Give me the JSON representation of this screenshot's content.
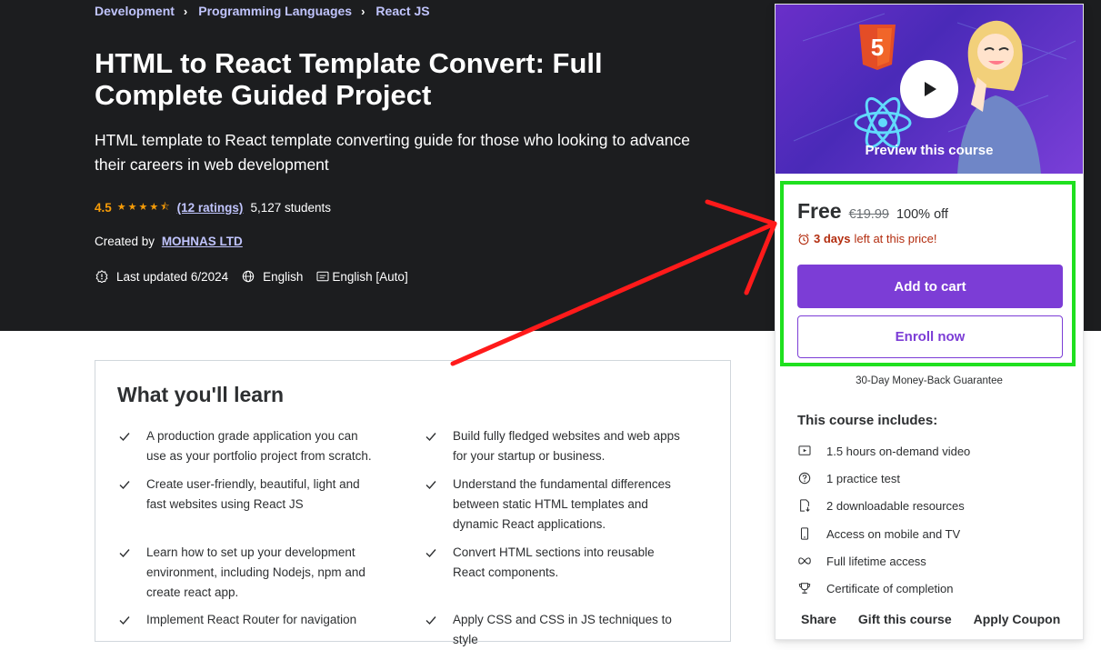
{
  "breadcrumbs": [
    "Development",
    "Programming Languages",
    "React JS"
  ],
  "course": {
    "title": "HTML to React Template Convert: Full Complete Guided Project",
    "subtitle": "HTML template to React template converting guide for those who looking to advance their careers in web development",
    "rating": "4.5",
    "stars": "★★★★⯪",
    "ratings_count": "(12 ratings)",
    "students": "5,127 students",
    "created_by_label": "Created by",
    "author": "MOHNAS LTD",
    "last_updated": "Last updated 6/2024",
    "language": "English",
    "captions": "English [Auto]"
  },
  "learn": {
    "title": "What you'll learn",
    "items": [
      "A production grade application you can use as your portfolio project from scratch.",
      "Build fully fledged websites and web apps for your startup or business.",
      "Create user-friendly, beautiful, light and fast websites using React JS",
      "Understand the fundamental differences between static HTML templates and dynamic React applications.",
      "Learn how to set up your development environment, including Nodejs, npm and create react app.",
      "Convert HTML sections into reusable React components.",
      "Implement React Router for navigation",
      "Apply CSS and CSS in JS techniques to style"
    ]
  },
  "sidebar": {
    "preview_label": "Preview this course",
    "price": "Free",
    "old_price": "€19.99",
    "discount": "100% off",
    "timer_days": "3 days",
    "timer_rest": "left at this price!",
    "add_to_cart": "Add to cart",
    "enroll": "Enroll now",
    "guarantee": "30-Day Money-Back Guarantee",
    "includes_title": "This course includes:",
    "includes": [
      "1.5 hours on-demand video",
      "1 practice test",
      "2 downloadable resources",
      "Access on mobile and TV",
      "Full lifetime access",
      "Certificate of completion"
    ],
    "links": [
      "Share",
      "Gift this course",
      "Apply Coupon"
    ]
  },
  "colors": {
    "hero_bg": "#1c1d1f",
    "accent": "#7c3dd6",
    "rating": "#f69c08",
    "link": "#c0c4fc",
    "timer": "#b32d0f",
    "highlight": "#1fe01f",
    "annotation_arrow": "#ff1a1a"
  }
}
